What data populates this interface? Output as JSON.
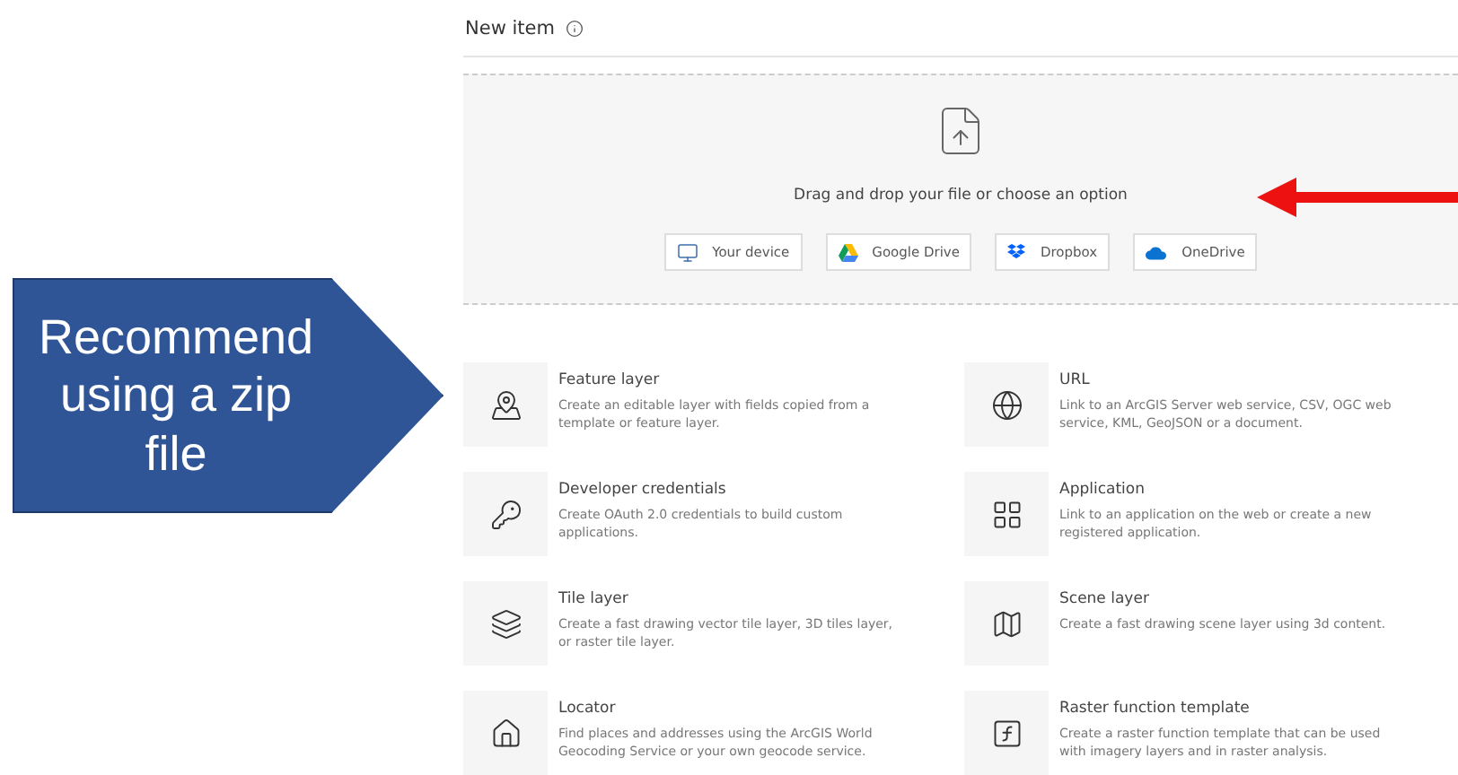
{
  "header": {
    "title": "New item"
  },
  "dropzone": {
    "prompt": "Drag and drop your file or choose an option",
    "sources": [
      {
        "label": "Your device"
      },
      {
        "label": "Google Drive"
      },
      {
        "label": "Dropbox"
      },
      {
        "label": "OneDrive"
      }
    ]
  },
  "items": [
    {
      "title": "Feature layer",
      "description": "Create an editable layer with fields copied from a template or feature layer."
    },
    {
      "title": "URL",
      "description": "Link to an ArcGIS Server web service, CSV, OGC web service, KML, GeoJSON or a document."
    },
    {
      "title": "Developer credentials",
      "description": "Create OAuth 2.0 credentials to build custom applications."
    },
    {
      "title": "Application",
      "description": "Link to an application on the web or create a new registered application."
    },
    {
      "title": "Tile layer",
      "description": "Create a fast drawing vector tile layer, 3D tiles layer, or raster tile layer."
    },
    {
      "title": "Scene layer",
      "description": "Create a fast drawing scene layer using 3d content."
    },
    {
      "title": "Locator",
      "description": "Find places and addresses using the ArcGIS World Geocoding Service or your own geocode service."
    },
    {
      "title": "Raster function template",
      "description": "Create a raster function template that can be used with imagery layers and in raster analysis."
    }
  ],
  "callout": {
    "text": "Recommend using a zip file"
  }
}
